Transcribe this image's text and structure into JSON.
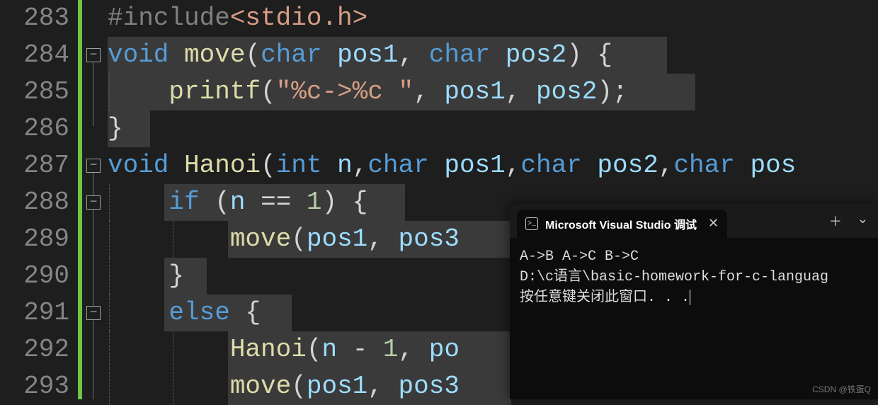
{
  "editor": {
    "lines": [
      {
        "num": "283",
        "fold": null
      },
      {
        "num": "284",
        "fold": "minus"
      },
      {
        "num": "285",
        "fold": null
      },
      {
        "num": "286",
        "fold": null
      },
      {
        "num": "287",
        "fold": "minus"
      },
      {
        "num": "288",
        "fold": "minus"
      },
      {
        "num": "289",
        "fold": null
      },
      {
        "num": "290",
        "fold": null
      },
      {
        "num": "291",
        "fold": "minus"
      },
      {
        "num": "292",
        "fold": null
      },
      {
        "num": "293",
        "fold": null
      }
    ],
    "code": {
      "l283": {
        "preproc": "#include",
        "path": "<stdio.h>"
      },
      "l284": {
        "kw_void": "void",
        "fn": "move",
        "t_char1": "char",
        "p1": "pos1",
        "t_char2": "char",
        "p2": "pos2",
        "brace": "{"
      },
      "l285": {
        "fn": "printf",
        "str": "\"%c->%c \"",
        "p1": "pos1",
        "p2": "pos2"
      },
      "l286": {
        "brace": "}"
      },
      "l287": {
        "kw_void": "void",
        "fn": "Hanoi",
        "t_int": "int",
        "pn": "n",
        "t_char1": "char",
        "p1": "pos1",
        "t_char2": "char",
        "p2": "pos2",
        "t_char3": "char",
        "p3": "pos"
      },
      "l288": {
        "kw_if": "if",
        "var": "n",
        "op": "==",
        "num": "1",
        "brace": "{"
      },
      "l289": {
        "fn": "move",
        "p1": "pos1",
        "p2": "pos3"
      },
      "l290": {
        "brace": "}"
      },
      "l291": {
        "kw_else": "else",
        "brace": "{"
      },
      "l292": {
        "fn": "Hanoi",
        "var": "n",
        "op": "-",
        "num": "1",
        "rest": "po"
      },
      "l293": {
        "fn": "move",
        "p1": "pos1",
        "p2": "pos3"
      }
    }
  },
  "terminal": {
    "tab_title": "Microsoft Visual Studio 调试",
    "output_line1": "A->B A->C B->C",
    "output_line2": "D:\\c语言\\basic-homework-for-c-languag",
    "output_line3": "按任意键关闭此窗口. . ."
  },
  "watermark": "CSDN @铁蛋Q"
}
